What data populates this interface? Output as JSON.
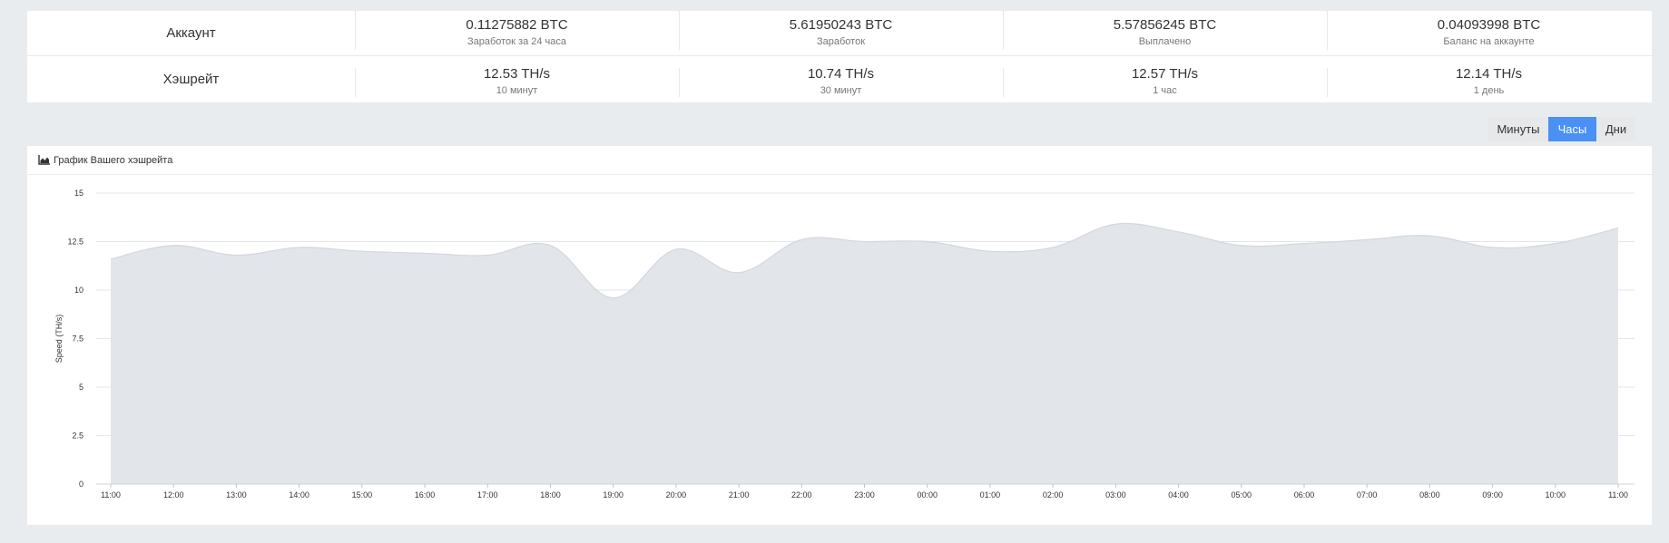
{
  "stats": {
    "rows": [
      {
        "label": "Аккаунт",
        "cells": [
          {
            "value": "0.11275882 BTC",
            "sub": "Заработок за 24 часа"
          },
          {
            "value": "5.61950243 BTC",
            "sub": "Заработок"
          },
          {
            "value": "5.57856245 BTC",
            "sub": "Выплачено"
          },
          {
            "value": "0.04093998 BTC",
            "sub": "Баланс на аккаунте"
          }
        ]
      },
      {
        "label": "Хэшрейт",
        "cells": [
          {
            "value": "12.53 TH/s",
            "sub": "10 минут"
          },
          {
            "value": "10.74 TH/s",
            "sub": "30 минут"
          },
          {
            "value": "12.57 TH/s",
            "sub": "1 час"
          },
          {
            "value": "12.14 TH/s",
            "sub": "1 день"
          }
        ]
      }
    ]
  },
  "range_buttons": {
    "minutes": "Минуты",
    "hours": "Часы",
    "days": "Дни",
    "active": "hours",
    "active_color": "#4a90f5"
  },
  "chart_panel": {
    "title": "График Вашего хэшрейта",
    "icon": "area-chart-icon"
  },
  "chart_data": {
    "type": "area",
    "title": "",
    "xlabel": "",
    "ylabel": "Speed (TH/s)",
    "ylim": [
      0,
      15
    ],
    "yticks": [
      "0",
      "2.5",
      "5",
      "7.5",
      "10",
      "12.5",
      "15"
    ],
    "grid": true,
    "x": [
      "11:00",
      "12:00",
      "13:00",
      "14:00",
      "15:00",
      "16:00",
      "17:00",
      "18:00",
      "19:00",
      "20:00",
      "21:00",
      "22:00",
      "23:00",
      "00:00",
      "01:00",
      "02:00",
      "03:00",
      "04:00",
      "05:00",
      "06:00",
      "07:00",
      "08:00",
      "09:00",
      "10:00",
      "11:00"
    ],
    "series": [
      {
        "values": [
          11.6,
          12.3,
          11.8,
          12.2,
          12.0,
          11.9,
          11.8,
          12.3,
          9.6,
          12.1,
          10.9,
          12.6,
          12.5,
          12.5,
          12.0,
          12.2,
          13.4,
          13.0,
          12.3,
          12.4,
          12.6,
          12.8,
          12.2,
          12.4,
          13.2
        ],
        "color": "#dfe2e8"
      }
    ]
  }
}
